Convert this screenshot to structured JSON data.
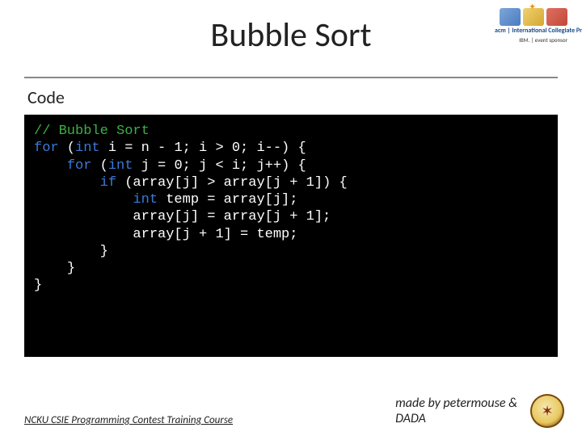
{
  "title": "Bubble Sort",
  "subheading": "Code",
  "top_logos": {
    "acm_text": "acm | International Collegiate Programming Contest",
    "ibm_text": "IBM. | event sponsor"
  },
  "code": {
    "comment": "// Bubble Sort",
    "kw_for": "for",
    "kw_int": "int",
    "kw_if": "if",
    "l2_a": " (",
    "l2_b": " i = n - 1; i > 0; i--) {",
    "l3_a": " (",
    "l3_b": " j = 0; j < i; j++) {",
    "l4": " (array[j] > array[j + 1]) {",
    "l5_a": " temp = array[j];",
    "l6": "array[j] = array[j + 1];",
    "l7": "array[j + 1] = temp;",
    "l8": "}",
    "l9": "}",
    "l10": "}"
  },
  "footer": {
    "left": "  NCKU CSIE Programming Contest Training Course   ",
    "right_line1": "made by petermouse &",
    "right_line2": "DADA"
  }
}
